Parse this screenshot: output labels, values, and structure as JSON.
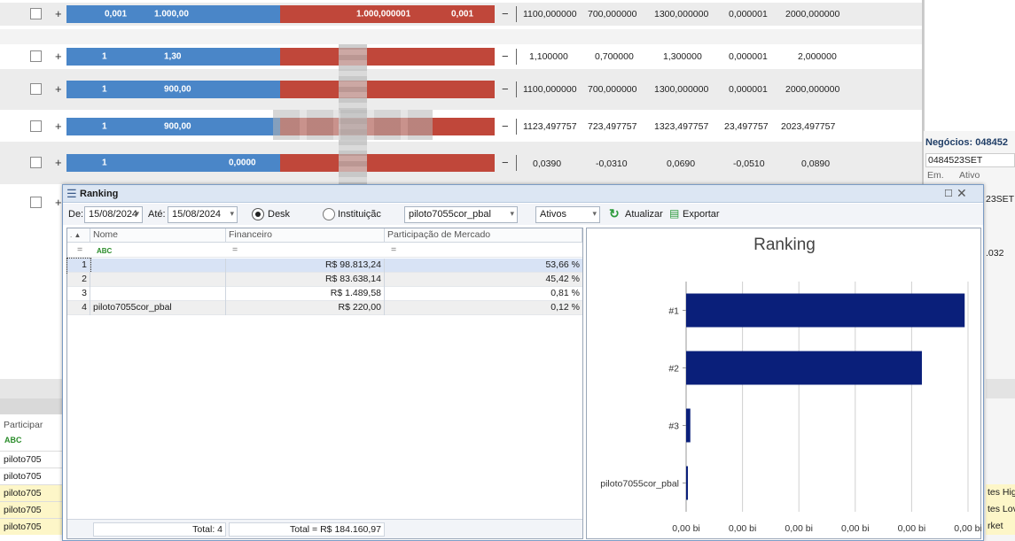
{
  "book": {
    "rows": [
      {
        "bid_qty": "0,001",
        "bid_price": "1.000,00",
        "ask_price": "1.000,000001",
        "ask_qty": "0,001",
        "cols": [
          "1100,000000",
          "700,000000",
          "1300,000000",
          "0,000001",
          "2000,000000"
        ]
      },
      {
        "bid_qty": "1",
        "bid_price": "1,30",
        "ask_price": "",
        "ask_qty": "",
        "cols": [
          "1,100000",
          "0,700000",
          "1,300000",
          "0,000001",
          "2,000000"
        ]
      },
      {
        "bid_qty": "1",
        "bid_price": "900,00",
        "ask_price": "",
        "ask_qty": "",
        "cols": [
          "1100,000000",
          "700,000000",
          "1300,000000",
          "0,000001",
          "2000,000000"
        ]
      },
      {
        "bid_qty": "1",
        "bid_price": "900,00",
        "ask_price": "",
        "ask_qty": "",
        "cols": [
          "1123,497757",
          "723,497757",
          "1323,497757",
          "23,497757",
          "2023,497757"
        ]
      },
      {
        "bid_qty": "1",
        "bid_price": "0,0000",
        "ask_price": "",
        "ask_qty": "",
        "cols": [
          "0,0390",
          "-0,0310",
          "0,0690",
          "-0,0510",
          "0,0890"
        ]
      }
    ],
    "plus": "+",
    "minus": "−"
  },
  "right_panel": {
    "title": "Negócios: 048452",
    "symbol": "0484523SET",
    "col1": "Em.",
    "col2": "Ativo",
    "cell": "23SET",
    "value": ".032",
    "bottom": [
      "tes Hig",
      "tes Lov",
      "rket"
    ]
  },
  "bottom_left": {
    "header": "Participar",
    "rows": [
      "piloto705",
      "piloto705",
      "piloto705",
      "piloto705",
      "piloto705"
    ]
  },
  "window": {
    "title": "Ranking",
    "close_icon": "close-icon",
    "restore_icon": "restore-icon",
    "toolbar": {
      "de_label": "De:",
      "de_value": "15/08/2024",
      "ate_label": "Até:",
      "ate_value": "15/08/2024",
      "desk_label": "Desk",
      "instituicao_label": "Instituiçãc",
      "user_value": "piloto7055cor_pbal",
      "ativos_value": "Ativos",
      "atualizar_label": "Atualizar",
      "exportar_label": "Exportar"
    },
    "grid": {
      "headers": [
        "Nome",
        "Financeiro",
        "Participação de Mercado"
      ],
      "filter_symbol": "=",
      "rows": [
        {
          "idx": "1",
          "nome": "",
          "financeiro": "R$ 98.813,24",
          "part": "53,66 %"
        },
        {
          "idx": "2",
          "nome": "",
          "financeiro": "R$ 83.638,14",
          "part": "45,42 %"
        },
        {
          "idx": "3",
          "nome": "",
          "financeiro": "R$ 1.489,58",
          "part": "0,81 %"
        },
        {
          "idx": "4",
          "nome": "piloto7055cor_pbal",
          "financeiro": "R$ 220,00",
          "part": "0,12 %"
        }
      ],
      "total_count": "Total: 4",
      "total_value": "Total = R$ 184.160,97"
    }
  },
  "chart_data": {
    "type": "bar",
    "title": "Ranking",
    "categories": [
      "#1",
      "#2",
      "#3",
      "piloto7055cor_pbal"
    ],
    "values": [
      98813.24,
      83638.14,
      1489.58,
      220.0
    ],
    "x_tick_labels": [
      "0,00 bi",
      "0,00 bi",
      "0,00 bi",
      "0,00 bi",
      "0,00 bi",
      "0,00 bi"
    ],
    "bar_color": "#0a1f7a",
    "grid": true
  }
}
